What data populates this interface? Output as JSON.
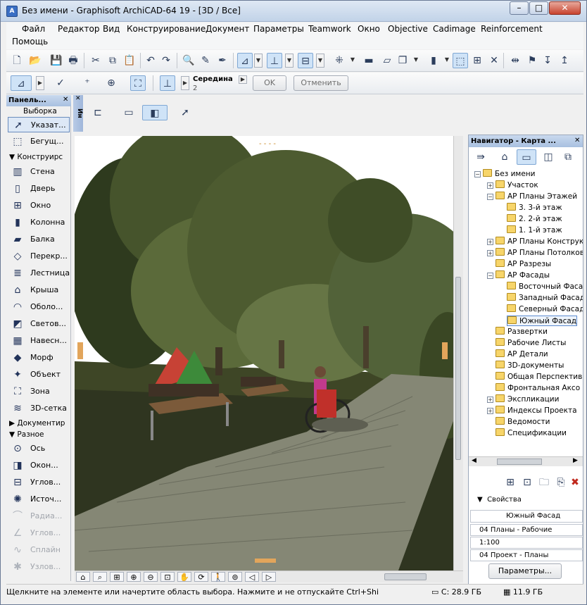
{
  "window": {
    "title": "Без имени - Graphisoft ArchiCAD-64 19 - [3D / Все]",
    "minimize": "–",
    "maximize": "□",
    "close": "✕"
  },
  "menu": [
    "Файл",
    "Редактор",
    "Вид",
    "Конструирование",
    "Документ",
    "Параметры",
    "Teamwork",
    "Окно",
    "Objective",
    "Cadimage",
    "Reinforcement",
    "Помощь"
  ],
  "info_toolbar": {
    "snap_label": "Середина",
    "snap_value": "2",
    "ok": "OK",
    "cancel": "Отменить"
  },
  "toolbox": {
    "title": "Панель...",
    "select_section": "Выборка",
    "select_items": [
      "Указат...",
      "Бегущ..."
    ],
    "design_section": "Конструирс",
    "design_items": [
      {
        "label": "Стена",
        "icon": "wall-icon"
      },
      {
        "label": "Дверь",
        "icon": "door-icon"
      },
      {
        "label": "Окно",
        "icon": "window-icon"
      },
      {
        "label": "Колонна",
        "icon": "column-icon"
      },
      {
        "label": "Балка",
        "icon": "beam-icon"
      },
      {
        "label": "Перекр...",
        "icon": "slab-icon"
      },
      {
        "label": "Лестница",
        "icon": "stair-icon"
      },
      {
        "label": "Крыша",
        "icon": "roof-icon"
      },
      {
        "label": "Оболо...",
        "icon": "shell-icon"
      },
      {
        "label": "Светов...",
        "icon": "skylight-icon"
      },
      {
        "label": "Навесн...",
        "icon": "curtain-wall-icon"
      },
      {
        "label": "Морф",
        "icon": "morph-icon"
      },
      {
        "label": "Объект",
        "icon": "object-icon"
      },
      {
        "label": "Зона",
        "icon": "zone-icon"
      },
      {
        "label": "3D-сетка",
        "icon": "mesh-icon"
      }
    ],
    "document_section": "Документир",
    "misc_section": "Разное",
    "misc_items": [
      {
        "label": "Ось",
        "icon": "grid-element-icon",
        "dim": false
      },
      {
        "label": "Окон...",
        "icon": "wall-end-icon",
        "dim": false
      },
      {
        "label": "Углов...",
        "icon": "corner-window-icon",
        "dim": false
      },
      {
        "label": "Источ...",
        "icon": "lamp-icon",
        "dim": false
      },
      {
        "label": "Радиа...",
        "icon": "radial-dimension-icon",
        "dim": true
      },
      {
        "label": "Углов...",
        "icon": "angle-dimension-icon",
        "dim": true
      },
      {
        "label": "Сплайн",
        "icon": "spline-icon",
        "dim": true
      },
      {
        "label": "Узлов...",
        "icon": "hotspot-icon",
        "dim": true
      }
    ]
  },
  "infobox_strip": "Ин",
  "navigator": {
    "title": "Навигатор - Карта ...",
    "tree": [
      {
        "label": "Без имени",
        "level": 0,
        "pm": "−"
      },
      {
        "label": "Участок",
        "level": 1,
        "pm": "+"
      },
      {
        "label": "АР Планы Этажей",
        "level": 1,
        "pm": "−"
      },
      {
        "label": "3. 3-й этаж",
        "level": 2,
        "pm": ""
      },
      {
        "label": "2. 2-й этаж",
        "level": 2,
        "pm": ""
      },
      {
        "label": "1. 1-й этаж",
        "level": 2,
        "pm": ""
      },
      {
        "label": "АР Планы Конструк",
        "level": 1,
        "pm": "+"
      },
      {
        "label": "АР Планы Потолков",
        "level": 1,
        "pm": "+"
      },
      {
        "label": "АР Разрезы",
        "level": 1,
        "pm": ""
      },
      {
        "label": "АР Фасады",
        "level": 1,
        "pm": "−"
      },
      {
        "label": "Восточный Фасад",
        "level": 2,
        "pm": ""
      },
      {
        "label": "Западный Фасад",
        "level": 2,
        "pm": ""
      },
      {
        "label": "Северный Фасад",
        "level": 2,
        "pm": ""
      },
      {
        "label": "Южный Фасад",
        "level": 2,
        "pm": "",
        "sel": true
      },
      {
        "label": "Развертки",
        "level": 1,
        "pm": ""
      },
      {
        "label": "Рабочие Листы",
        "level": 1,
        "pm": ""
      },
      {
        "label": "АР Детали",
        "level": 1,
        "pm": ""
      },
      {
        "label": "3D-документы",
        "level": 1,
        "pm": ""
      },
      {
        "label": "Общая Перспектив",
        "level": 1,
        "pm": ""
      },
      {
        "label": "Фронтальная Аксо",
        "level": 1,
        "pm": ""
      },
      {
        "label": "Экспликации",
        "level": 1,
        "pm": "+"
      },
      {
        "label": "Индексы Проекта",
        "level": 1,
        "pm": "+"
      },
      {
        "label": "Ведомости",
        "level": 1,
        "pm": ""
      },
      {
        "label": "Спецификации",
        "level": 1,
        "pm": ""
      }
    ],
    "properties": "Свойства",
    "prop_name": "Южный Фасад",
    "prop_layer": "04 Планы - Рабочие",
    "prop_scale": "1:100",
    "prop_penset": "04 Проект - Планы",
    "params_button": "Параметры..."
  },
  "status": {
    "hint": "Щелкните на элементе или начертите область выбора. Нажмите и не отпускайте Ctrl+Shi",
    "disk": "C: 28.9 ГБ",
    "ram": "11.9 ГБ"
  },
  "colors": {
    "accent": "#3a6fc4",
    "nav_header": "#a8c0e0",
    "selection": "#dde8f6"
  }
}
